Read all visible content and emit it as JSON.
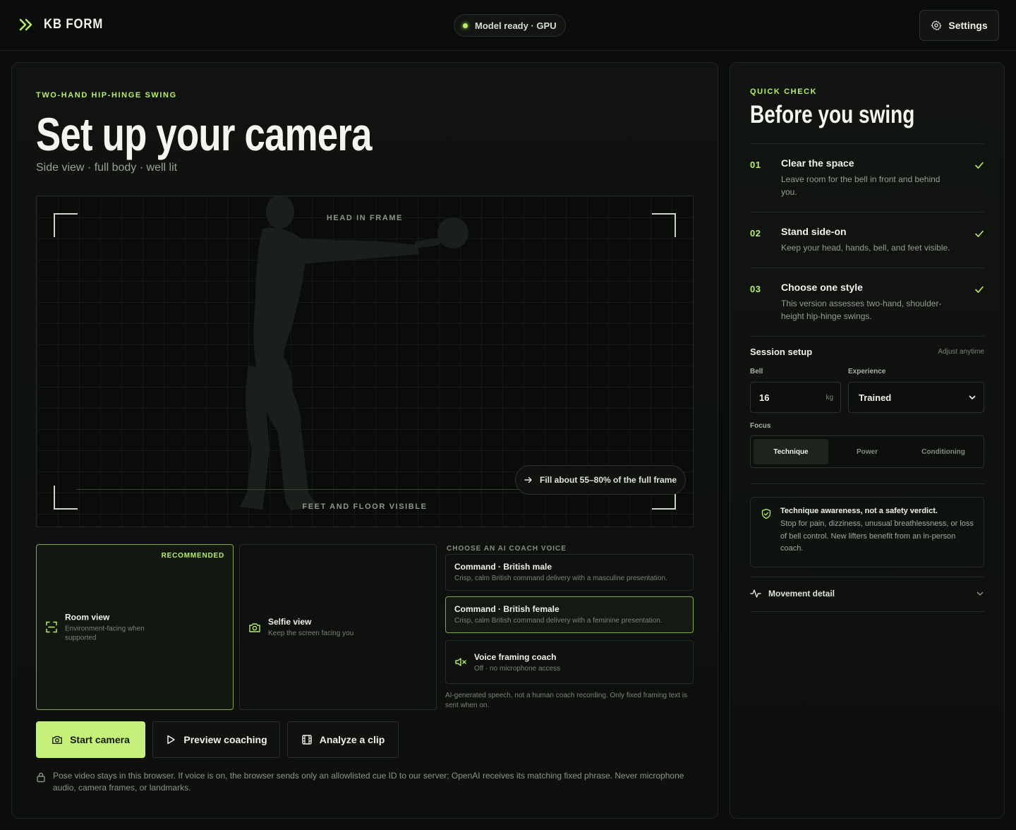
{
  "header": {
    "brand": "KB FORM",
    "status": "Model ready · GPU",
    "settings_label": "Settings"
  },
  "main": {
    "eyebrow": "TWO-HAND HIP-HINGE SWING",
    "title": "Set up your camera",
    "subtitle": "Side view · full body · well lit",
    "camera": {
      "top_label": "HEAD IN FRAME",
      "bottom_label": "FEET AND FLOOR VISIBLE",
      "fill_hint": "Fill about 55–80% of the full frame"
    },
    "views": {
      "room": {
        "badge": "RECOMMENDED",
        "title": "Room view",
        "desc": "Environment-facing when supported"
      },
      "selfie": {
        "title": "Selfie view",
        "desc": "Keep the screen facing you"
      }
    },
    "voice": {
      "heading": "CHOOSE AN AI COACH VOICE",
      "options": [
        {
          "title": "Command · British male",
          "desc": "Crisp, calm British command delivery with a masculine presentation."
        },
        {
          "title": "Command · British female",
          "desc": "Crisp, calm British command delivery with a feminine presentation."
        },
        {
          "title": "Voice framing coach",
          "desc": "Off · no microphone access"
        }
      ],
      "disclaimer": "AI-generated speech, not a human coach recording. Only fixed framing text is sent when on."
    },
    "actions": {
      "start": "Start camera",
      "preview": "Preview coaching",
      "analyze": "Analyze a clip"
    },
    "privacy": "Pose video stays in this browser. If voice is on, the browser sends only an allowlisted cue ID to our server; OpenAI receives its matching fixed phrase. Never microphone audio, camera frames, or landmarks."
  },
  "side": {
    "eyebrow": "QUICK CHECK",
    "title": "Before you swing",
    "checks": [
      {
        "num": "01",
        "title": "Clear the space",
        "desc": "Leave room for the bell in front and behind you."
      },
      {
        "num": "02",
        "title": "Stand side-on",
        "desc": "Keep your head, hands, bell, and feet visible."
      },
      {
        "num": "03",
        "title": "Choose one style",
        "desc": "This version assesses two-hand, shoulder-height hip-hinge swings."
      }
    ],
    "session": {
      "label": "Session setup",
      "hint": "Adjust anytime",
      "bell_label": "Bell",
      "bell_value": "16",
      "bell_unit": "kg",
      "experience_label": "Experience",
      "experience_value": "Trained",
      "focus_label": "Focus",
      "focus_options": [
        "Technique",
        "Power",
        "Conditioning"
      ]
    },
    "safety": {
      "title": "Technique awareness, not a safety verdict.",
      "text": "Stop for pain, dizziness, unusual breathlessness, or loss of bell control. New lifters benefit from an in-person coach."
    },
    "movement_label": "Movement detail"
  },
  "colors": {
    "accent": "#b8ee6a",
    "primary_button": "#c5f07a",
    "background": "#0b0d0b"
  }
}
